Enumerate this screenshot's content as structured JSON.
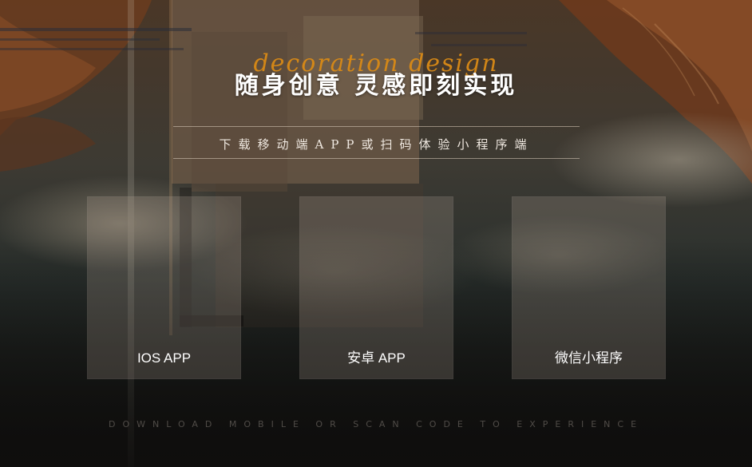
{
  "hero": {
    "script_title": "decoration  design",
    "main_title": "随身创意  灵感即刻实现",
    "subtitle": "下载移动端APP或扫码体验小程序端"
  },
  "cards": [
    {
      "label": "IOS APP"
    },
    {
      "label": "安卓 APP"
    },
    {
      "label": "微信小程序"
    }
  ],
  "footer": {
    "text": "DOWNLOAD MOBILE OR SCAN CODE TO EXPERIENCE"
  },
  "colors": {
    "accent": "#d98a16",
    "background": "#1d1a17"
  }
}
